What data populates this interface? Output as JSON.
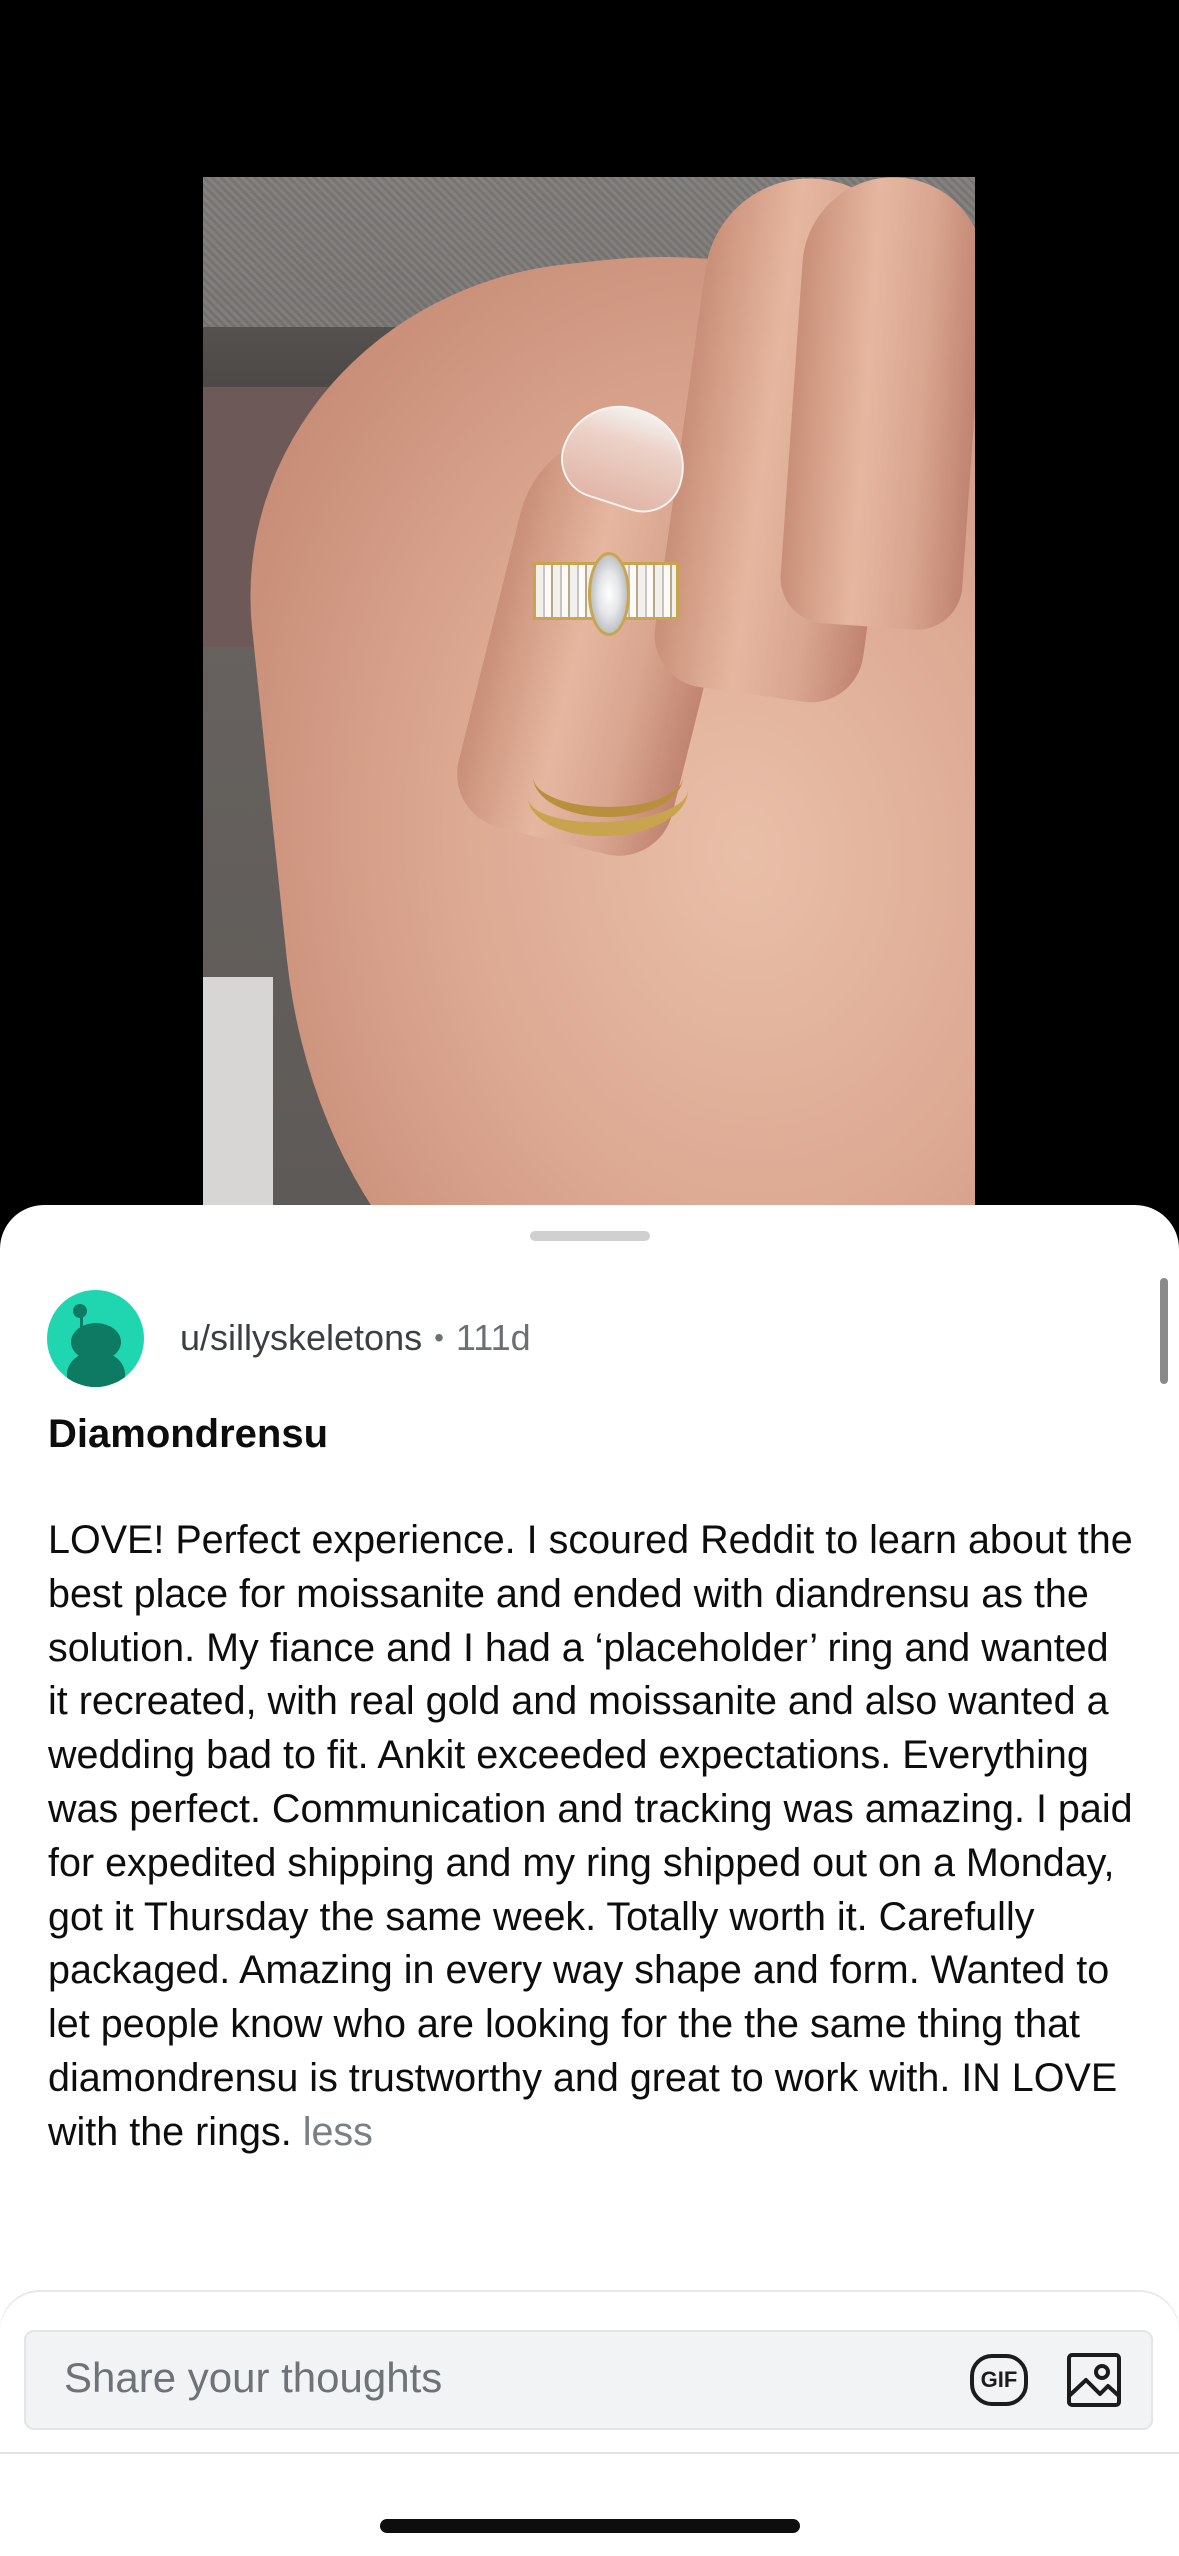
{
  "post": {
    "username": "u/sillyskeletons",
    "separator": "•",
    "age": "111d",
    "title": "Diamondrensu",
    "body": "LOVE! Perfect experience. I scoured Reddit to learn about the best place for moissanite and ended with diandrensu as the solution. My fiance and I had a ‘placeholder’ ring and wanted it recreated, with real gold and moissanite and also wanted a wedding bad to fit. Ankit exceeded expectations. Everything was perfect. Communication and tracking was amazing. I paid for expedited shipping and my ring shipped out on a Monday, got it Thursday the same week. Totally worth it. Carefully packaged. Amazing in every way shape and form. Wanted to let people know who are looking for the the same thing that diamondrensu is trustworthy and great to work with. IN LOVE with the rings.",
    "less_label": "less"
  },
  "composer": {
    "placeholder": "Share your thoughts",
    "gif_label": "GIF",
    "image_icon": "image-icon"
  },
  "colors": {
    "avatar_bg": "#1fd6b0",
    "avatar_fg": "#0e7a63",
    "text": "#0d0d0d",
    "muted": "#6b7075"
  }
}
